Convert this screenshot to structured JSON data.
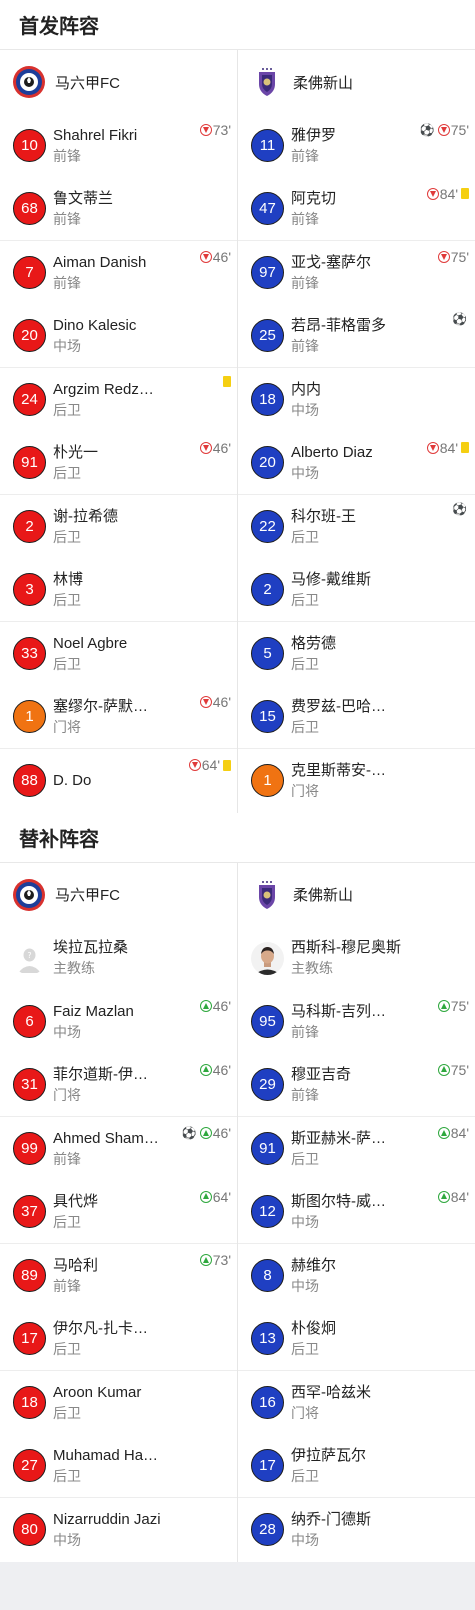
{
  "colors": {
    "red": "#e81818",
    "blue": "#1f3fc2",
    "orange": "#f07312",
    "sub_out": "#e03a3a",
    "sub_in": "#2fa83e",
    "yellow_card": "#f5cf12"
  },
  "starting": {
    "title": "首发阵容",
    "home_team": "马六甲FC",
    "away_team": "柔佛新山",
    "home": [
      {
        "num": "10",
        "name": "Shahrel Fikri",
        "pos": "前锋",
        "color": "red",
        "events": [
          {
            "t": "sub_out"
          },
          {
            "t": "min",
            "v": "73'"
          }
        ]
      },
      {
        "num": "68",
        "name": "鲁文蒂兰",
        "pos": "前锋",
        "color": "red",
        "events": []
      },
      {
        "num": "7",
        "name": "Aiman Danish",
        "pos": "前锋",
        "color": "red",
        "events": [
          {
            "t": "sub_out"
          },
          {
            "t": "min",
            "v": "46'"
          }
        ]
      },
      {
        "num": "20",
        "name": "Dino Kalesic",
        "pos": "中场",
        "color": "red",
        "events": []
      },
      {
        "num": "24",
        "name": "Argzim Redz…",
        "pos": "后卫",
        "color": "red",
        "events": [
          {
            "t": "yellow"
          }
        ]
      },
      {
        "num": "91",
        "name": "朴光一",
        "pos": "后卫",
        "color": "red",
        "events": [
          {
            "t": "sub_out"
          },
          {
            "t": "min",
            "v": "46'"
          }
        ]
      },
      {
        "num": "2",
        "name": "谢-拉希德",
        "pos": "后卫",
        "color": "red",
        "events": []
      },
      {
        "num": "3",
        "name": "林博",
        "pos": "后卫",
        "color": "red",
        "events": []
      },
      {
        "num": "33",
        "name": "Noel Agbre",
        "pos": "后卫",
        "color": "red",
        "events": []
      },
      {
        "num": "1",
        "name": "塞缪尔-萨默…",
        "pos": "门将",
        "color": "orange",
        "events": [
          {
            "t": "sub_out"
          },
          {
            "t": "min",
            "v": "46'"
          }
        ]
      },
      {
        "num": "88",
        "name": "D. Do",
        "pos": "",
        "color": "red",
        "events": [
          {
            "t": "sub_out"
          },
          {
            "t": "min",
            "v": "64'"
          },
          {
            "t": "yellow"
          }
        ]
      }
    ],
    "away": [
      {
        "num": "11",
        "name": "雅伊罗",
        "pos": "前锋",
        "color": "blue",
        "events": [
          {
            "t": "goal"
          },
          {
            "t": "sub_out"
          },
          {
            "t": "min",
            "v": "75'"
          }
        ]
      },
      {
        "num": "47",
        "name": "阿克切",
        "pos": "前锋",
        "color": "blue",
        "events": [
          {
            "t": "sub_out"
          },
          {
            "t": "min",
            "v": "84'"
          },
          {
            "t": "yellow"
          }
        ]
      },
      {
        "num": "97",
        "name": "亚戈-塞萨尔",
        "pos": "前锋",
        "color": "blue",
        "events": [
          {
            "t": "sub_out"
          },
          {
            "t": "min",
            "v": "75'"
          }
        ]
      },
      {
        "num": "25",
        "name": "若昂-菲格雷多",
        "pos": "前锋",
        "color": "blue",
        "events": [
          {
            "t": "goal"
          }
        ]
      },
      {
        "num": "18",
        "name": "内内",
        "pos": "中场",
        "color": "blue",
        "events": []
      },
      {
        "num": "20",
        "name": "Alberto Diaz",
        "pos": "中场",
        "color": "blue",
        "events": [
          {
            "t": "sub_out"
          },
          {
            "t": "min",
            "v": "84'"
          },
          {
            "t": "yellow"
          }
        ]
      },
      {
        "num": "22",
        "name": "科尔班-王",
        "pos": "后卫",
        "color": "blue",
        "events": [
          {
            "t": "goal"
          }
        ]
      },
      {
        "num": "2",
        "name": "马修-戴维斯",
        "pos": "后卫",
        "color": "blue",
        "events": []
      },
      {
        "num": "5",
        "name": "格劳德",
        "pos": "后卫",
        "color": "blue",
        "events": []
      },
      {
        "num": "15",
        "name": "费罗兹-巴哈…",
        "pos": "后卫",
        "color": "blue",
        "events": []
      },
      {
        "num": "1",
        "name": "克里斯蒂安-…",
        "pos": "门将",
        "color": "orange",
        "events": []
      }
    ]
  },
  "subs": {
    "title": "替补阵容",
    "home_team": "马六甲FC",
    "away_team": "柔佛新山",
    "home_coach": {
      "name": "埃拉瓦拉桑",
      "role": "主教练"
    },
    "away_coach": {
      "name": "西斯科-穆尼奥斯",
      "role": "主教练"
    },
    "home": [
      {
        "num": "6",
        "name": "Faiz Mazlan",
        "pos": "中场",
        "color": "red",
        "events": [
          {
            "t": "sub_in"
          },
          {
            "t": "min",
            "v": "46'"
          }
        ]
      },
      {
        "num": "31",
        "name": "菲尔道斯-伊…",
        "pos": "门将",
        "color": "red",
        "events": [
          {
            "t": "sub_in"
          },
          {
            "t": "min",
            "v": "46'"
          }
        ]
      },
      {
        "num": "99",
        "name": "Ahmed Sham…",
        "pos": "前锋",
        "color": "red",
        "events": [
          {
            "t": "goal"
          },
          {
            "t": "sub_in"
          },
          {
            "t": "min",
            "v": "46'"
          }
        ]
      },
      {
        "num": "37",
        "name": "具代烨",
        "pos": "后卫",
        "color": "red",
        "events": [
          {
            "t": "sub_in"
          },
          {
            "t": "min",
            "v": "64'"
          }
        ]
      },
      {
        "num": "89",
        "name": "马哈利",
        "pos": "前锋",
        "color": "red",
        "events": [
          {
            "t": "sub_in"
          },
          {
            "t": "min",
            "v": "73'"
          }
        ]
      },
      {
        "num": "17",
        "name": "伊尔凡-扎卡…",
        "pos": "后卫",
        "color": "red",
        "events": []
      },
      {
        "num": "18",
        "name": "Aroon Kumar",
        "pos": "后卫",
        "color": "red",
        "events": []
      },
      {
        "num": "27",
        "name": "Muhamad Ha…",
        "pos": "后卫",
        "color": "red",
        "events": []
      },
      {
        "num": "80",
        "name": "Nizarruddin Jazi",
        "pos": "中场",
        "color": "red",
        "events": []
      }
    ],
    "away": [
      {
        "num": "95",
        "name": "马科斯-吉列…",
        "pos": "前锋",
        "color": "blue",
        "events": [
          {
            "t": "sub_in"
          },
          {
            "t": "min",
            "v": "75'"
          }
        ]
      },
      {
        "num": "29",
        "name": "穆亚吉奇",
        "pos": "前锋",
        "color": "blue",
        "events": [
          {
            "t": "sub_in"
          },
          {
            "t": "min",
            "v": "75'"
          }
        ]
      },
      {
        "num": "91",
        "name": "斯亚赫米-萨…",
        "pos": "后卫",
        "color": "blue",
        "events": [
          {
            "t": "sub_in"
          },
          {
            "t": "min",
            "v": "84'"
          }
        ]
      },
      {
        "num": "12",
        "name": "斯图尔特-威…",
        "pos": "中场",
        "color": "blue",
        "events": [
          {
            "t": "sub_in"
          },
          {
            "t": "min",
            "v": "84'"
          }
        ]
      },
      {
        "num": "8",
        "name": "赫维尔",
        "pos": "中场",
        "color": "blue",
        "events": []
      },
      {
        "num": "13",
        "name": "朴俊炯",
        "pos": "后卫",
        "color": "blue",
        "events": []
      },
      {
        "num": "16",
        "name": "西罕-哈兹米",
        "pos": "门将",
        "color": "blue",
        "events": []
      },
      {
        "num": "17",
        "name": "伊拉萨瓦尔",
        "pos": "后卫",
        "color": "blue",
        "events": []
      },
      {
        "num": "28",
        "name": "纳乔-门德斯",
        "pos": "中场",
        "color": "blue",
        "events": []
      }
    ]
  }
}
